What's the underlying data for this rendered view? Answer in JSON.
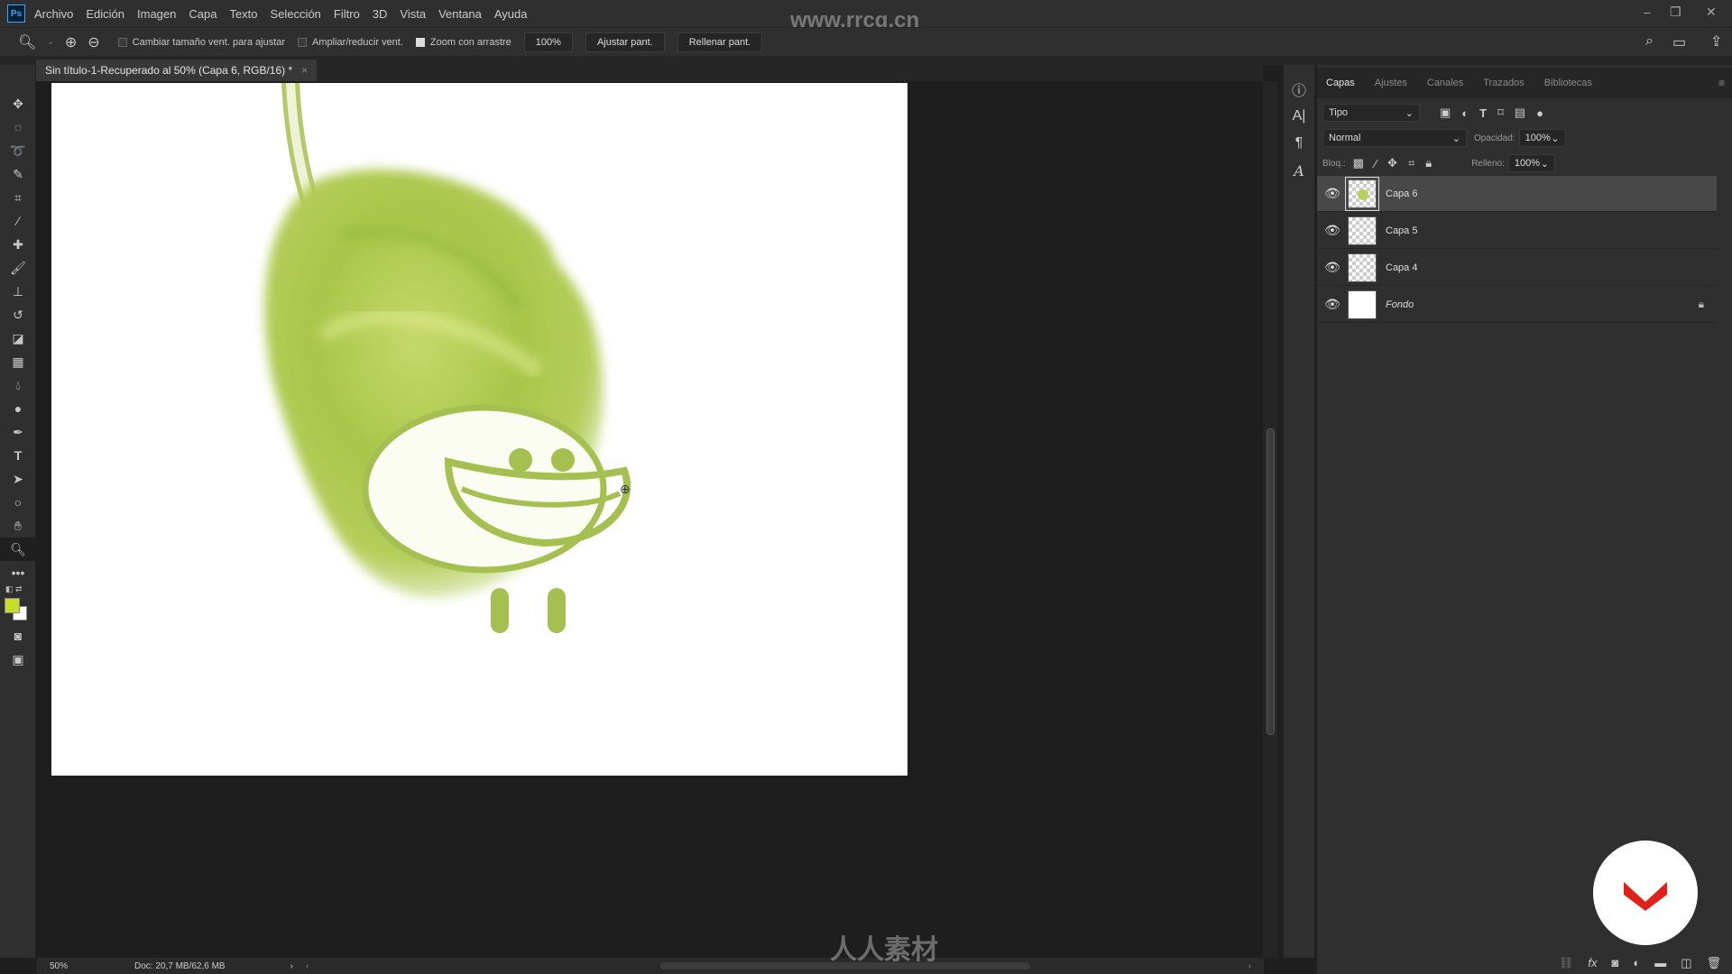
{
  "app": {
    "logo": "Ps",
    "menu": [
      "Archivo",
      "Edición",
      "Imagen",
      "Capa",
      "Texto",
      "Selección",
      "Filtro",
      "3D",
      "Vista",
      "Ventana",
      "Ayuda"
    ]
  },
  "options": {
    "checkboxes": [
      {
        "label": "Cambiar tamaño vent. para ajustar",
        "checked": false
      },
      {
        "label": "Ampliar/reducir vent.",
        "checked": false
      },
      {
        "label": "Zoom con arrastre",
        "checked": true
      }
    ],
    "zoom_value": "100%",
    "fit_screen": "Ajustar pant.",
    "fill_screen": "Rellenar pant."
  },
  "document": {
    "tab_title": "Sin título-1-Recuperado al 50% (Capa 6, RGB/16) *",
    "close": "×"
  },
  "colors": {
    "foreground": "#c8dc2a",
    "background": "#ffffff",
    "accent": "#31a8ff"
  },
  "layers_panel": {
    "tabs": [
      "Capas",
      "Ajustes",
      "Canales",
      "Trazados",
      "Bibliotecas"
    ],
    "filter": "Tipo",
    "blend_mode": "Normal",
    "opacity_label": "Opacidad:",
    "opacity": "100%",
    "lock_label": "Bloq.:",
    "fill_label": "Relleno:",
    "fill": "100%",
    "layers": [
      {
        "name": "Capa 6",
        "visible": true,
        "selected": true
      },
      {
        "name": "Capa 5",
        "visible": true
      },
      {
        "name": "Capa 4",
        "visible": true
      },
      {
        "name": "Fondo",
        "visible": true,
        "locked": true
      }
    ]
  },
  "status": {
    "zoom": "50%",
    "doc": "Doc: 20,7 MB/62,6 MB"
  },
  "watermarks": {
    "top": "www.rrcg.cn",
    "bottom": "人人素材"
  }
}
